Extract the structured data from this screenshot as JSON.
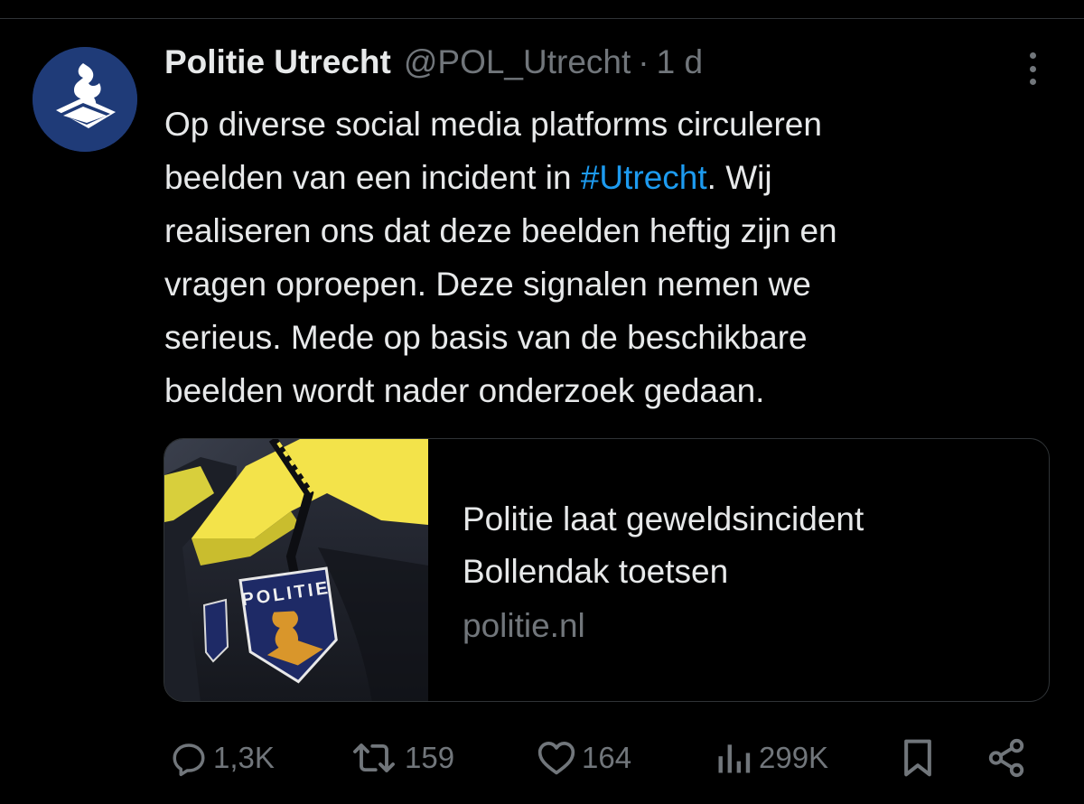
{
  "author": {
    "name": "Politie Utrecht",
    "handle": "@POL_Utrecht",
    "separator": "·",
    "time": "1 d"
  },
  "tweet": {
    "line1": "Op diverse social media platforms circuleren",
    "line2_before": "beelden van een incident in ",
    "hashtag": "#Utrecht",
    "line2_after": ". Wij",
    "line3": "realiseren ons dat deze beelden heftig zijn en",
    "line4": "vragen oproepen. Deze signalen nemen we",
    "line5": "serieus. Mede op basis van de beschikbare",
    "line6": "beelden wordt nader onderzoek gedaan."
  },
  "card": {
    "title_line1": "Politie laat geweldsincident",
    "title_line2": "Bollendak toetsen",
    "domain": "politie.nl",
    "badge_text": "POLITIE"
  },
  "actions": {
    "replies": "1,3K",
    "reposts": "159",
    "likes": "164",
    "views": "299K"
  },
  "icons": {
    "reply": "reply-icon",
    "repost": "repost-icon",
    "like": "heart-icon",
    "views": "views-icon",
    "bookmark": "bookmark-icon",
    "share": "share-icon",
    "more": "more-icon"
  },
  "colors": {
    "background": "#000000",
    "text": "#e7e9ea",
    "muted": "#71767b",
    "link": "#1d9bf0",
    "avatar": "#1f3b78",
    "uniform_yellow": "#f3e34a",
    "uniform_dark": "#23262f",
    "badge_blue": "#1e2a66",
    "badge_gold": "#d9962b"
  }
}
